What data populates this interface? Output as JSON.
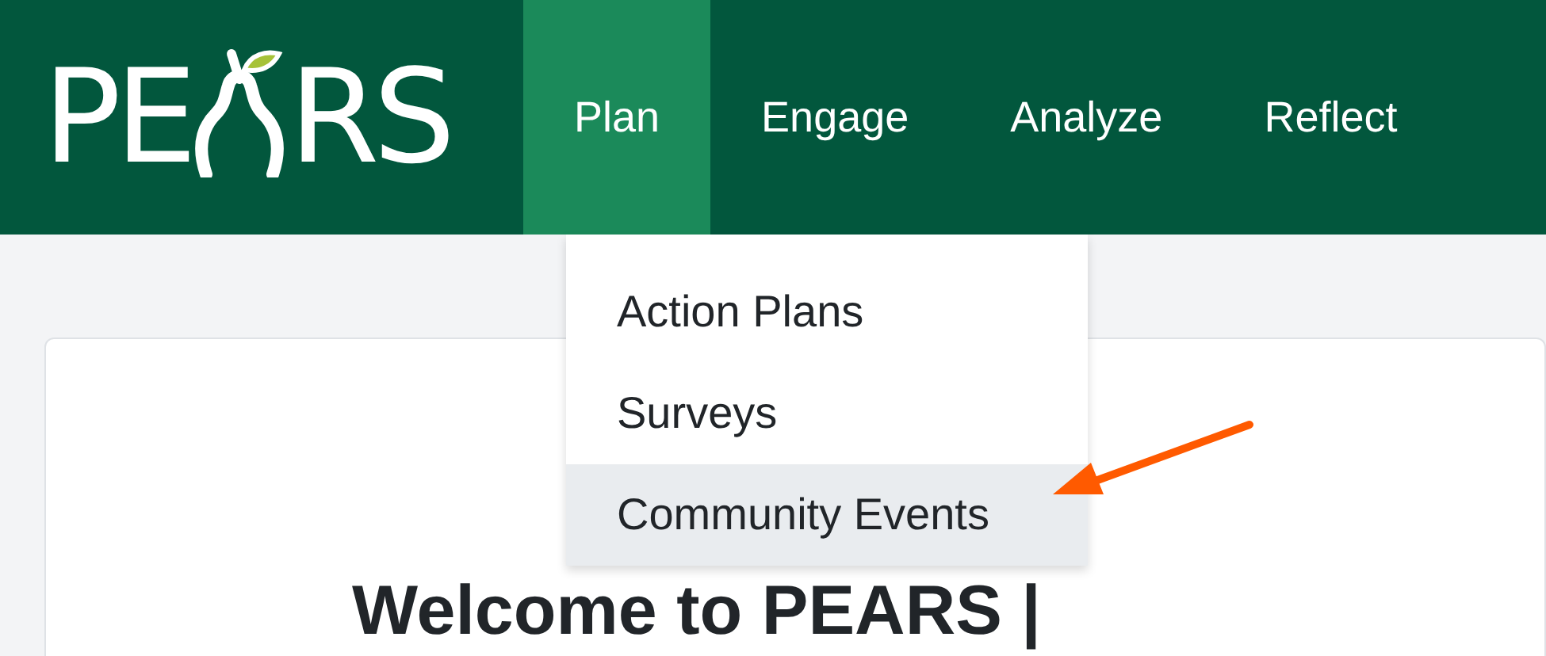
{
  "logo": {
    "left": "PE",
    "right": "RS"
  },
  "nav": [
    {
      "label": "Plan",
      "selected": true
    },
    {
      "label": "Engage",
      "selected": false
    },
    {
      "label": "Analyze",
      "selected": false
    },
    {
      "label": "Reflect",
      "selected": false
    }
  ],
  "dropdown": [
    {
      "label": "Action Plans",
      "selected": false
    },
    {
      "label": "Surveys",
      "selected": false
    },
    {
      "label": "Community Events",
      "selected": true
    }
  ],
  "heading": "Welcome to PEARS |"
}
